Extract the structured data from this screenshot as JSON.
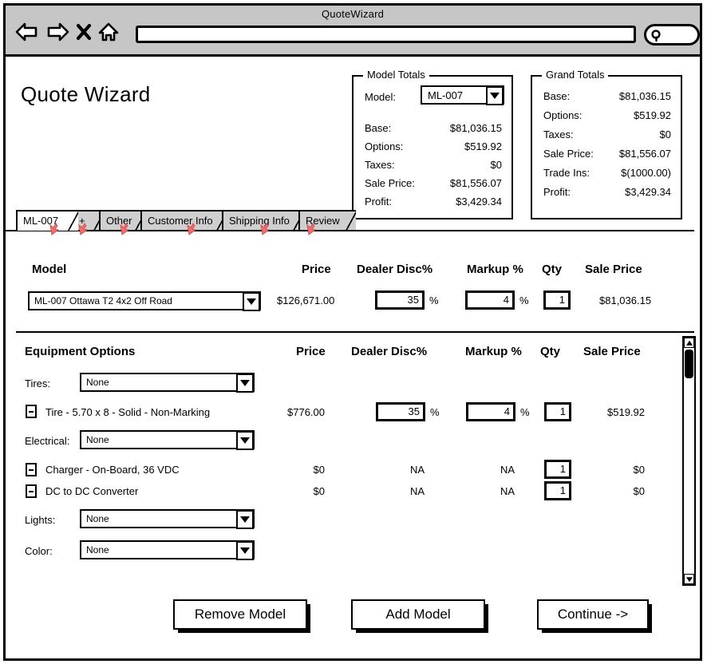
{
  "browser": {
    "title": "QuoteWizard",
    "url_value": "",
    "url_placeholder": "",
    "search_value": "",
    "nav": {
      "back": "back-arrow",
      "forward": "forward-arrow",
      "stop": "stop-x",
      "home": "home"
    }
  },
  "page": {
    "title": "Quote Wizard"
  },
  "model_totals": {
    "legend": "Model Totals",
    "model_label": "Model:",
    "model_value": "ML-007",
    "rows": [
      {
        "label": "Base:",
        "value": "$81,036.15"
      },
      {
        "label": "Options:",
        "value": "$519.92"
      },
      {
        "label": "Taxes:",
        "value": "$0"
      },
      {
        "label": "Sale Price:",
        "value": "$81,556.07"
      },
      {
        "label": "Profit:",
        "value": "$3,429.34"
      }
    ]
  },
  "grand_totals": {
    "legend": "Grand Totals",
    "rows": [
      {
        "label": "Base:",
        "value": "$81,036.15"
      },
      {
        "label": "Options:",
        "value": "$519.92"
      },
      {
        "label": "Taxes:",
        "value": "$0"
      },
      {
        "label": "Sale Price:",
        "value": "$81,556.07"
      },
      {
        "label": "Trade Ins:",
        "value": "$(1000.00)"
      },
      {
        "label": "Profit:",
        "value": "$3,429.34"
      }
    ]
  },
  "tabs": [
    {
      "label": "ML-007",
      "active": true
    },
    {
      "label": "+",
      "active": false
    },
    {
      "label": "Other",
      "active": false
    },
    {
      "label": "Customer Info",
      "active": false
    },
    {
      "label": "Shipping Info",
      "active": false
    },
    {
      "label": "Review",
      "active": false
    }
  ],
  "model_section": {
    "headers": {
      "name": "Model",
      "price": "Price",
      "dealer_disc": "Dealer Disc%",
      "markup": "Markup %",
      "qty": "Qty",
      "sale_price": "Sale Price"
    },
    "row": {
      "model_value": "ML-007 Ottawa T2 4x2 Off Road",
      "price": "$126,671.00",
      "dealer_disc": "35",
      "dealer_disc_suffix": "%",
      "markup": "4",
      "markup_suffix": "%",
      "qty": "1",
      "sale_price": "$81,036.15"
    }
  },
  "options_section": {
    "headers": {
      "name": "Equipment Options",
      "price": "Price",
      "dealer_disc": "Dealer Disc%",
      "markup": "Markup %",
      "qty": "Qty",
      "sale_price": "Sale Price"
    },
    "groups": [
      {
        "label": "Tires:",
        "select_value": "None",
        "items": [
          {
            "name": "Tire - 5.70 x 8 - Solid - Non-Marking",
            "price": "$776.00",
            "dealer_disc": "35",
            "dealer_disc_suffix": "%",
            "dealer_disc_editable": true,
            "markup": "4",
            "markup_suffix": "%",
            "markup_editable": true,
            "qty": "1",
            "sale_price": "$519.92"
          }
        ]
      },
      {
        "label": "Electrical:",
        "select_value": "None",
        "items": [
          {
            "name": "Charger - On-Board, 36 VDC",
            "price": "$0",
            "dealer_disc": "NA",
            "dealer_disc_suffix": "",
            "dealer_disc_editable": false,
            "markup": "NA",
            "markup_suffix": "",
            "markup_editable": false,
            "qty": "1",
            "sale_price": "$0"
          },
          {
            "name": "DC to DC Converter",
            "price": "$0",
            "dealer_disc": "NA",
            "dealer_disc_suffix": "",
            "dealer_disc_editable": false,
            "markup": "NA",
            "markup_suffix": "",
            "markup_editable": false,
            "qty": "1",
            "sale_price": "$0"
          }
        ]
      },
      {
        "label": "Lights:",
        "select_value": "None",
        "items": []
      },
      {
        "label": "Color:",
        "select_value": "None",
        "items": []
      }
    ]
  },
  "footer": {
    "remove_model": "Remove Model",
    "add_model": "Add Model",
    "continue": "Continue ->"
  },
  "colors": {
    "chrome": "#c6c6c6",
    "tab_inactive": "#cfcfcf",
    "ink": "#000000",
    "cursor_red": "#f07070"
  }
}
